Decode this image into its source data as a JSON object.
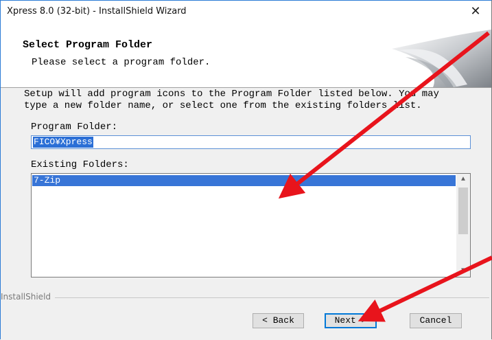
{
  "window": {
    "title": "Xpress 8.0 (32-bit) - InstallShield Wizard",
    "close_glyph": "✕"
  },
  "header": {
    "title": "Select Program Folder",
    "subtitle": "Please select a program folder."
  },
  "body": {
    "line1": "Setup will add program icons to the Program Folder listed below.  You may",
    "line2": "type a new folder name, or select one from the existing folders list.",
    "program_folder_label": "Program Folder:",
    "program_folder_value": "FICO¥Xpress",
    "existing_folders_label": "Existing Folders:",
    "existing_folders": [
      "7-Zip"
    ]
  },
  "footer": {
    "group_label": "InstallShield",
    "back_label": "< Back",
    "next_label": "Next >",
    "cancel_label": "Cancel"
  },
  "annotations": {
    "arrow_color": "#e8141c"
  }
}
